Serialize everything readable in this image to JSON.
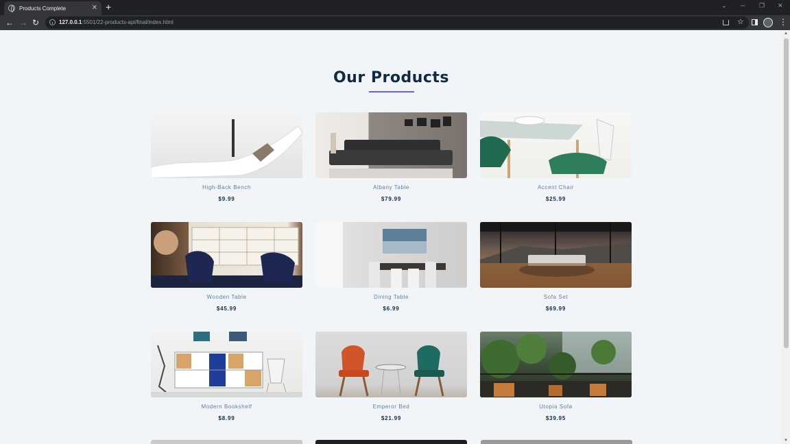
{
  "browser": {
    "tab_title": "Products Complete",
    "url_host": "127.0.0.1",
    "url_path": ":5501/22-products-api/final/index.html"
  },
  "page": {
    "title": "Our Products",
    "accent_color": "#645cff"
  },
  "products": [
    {
      "name": "High-Back Bench",
      "price": "$9.99"
    },
    {
      "name": "Albany Table",
      "price": "$79.99"
    },
    {
      "name": "Accent Chair",
      "price": "$25.99"
    },
    {
      "name": "Wooden Table",
      "price": "$45.99"
    },
    {
      "name": "Dining Table",
      "price": "$6.99"
    },
    {
      "name": "Sofa Set",
      "price": "$69.99"
    },
    {
      "name": "Modern Bookshelf",
      "price": "$8.99"
    },
    {
      "name": "Emperor Bed",
      "price": "$21.99"
    },
    {
      "name": "Utopia Sofa",
      "price": "$39.95"
    }
  ]
}
